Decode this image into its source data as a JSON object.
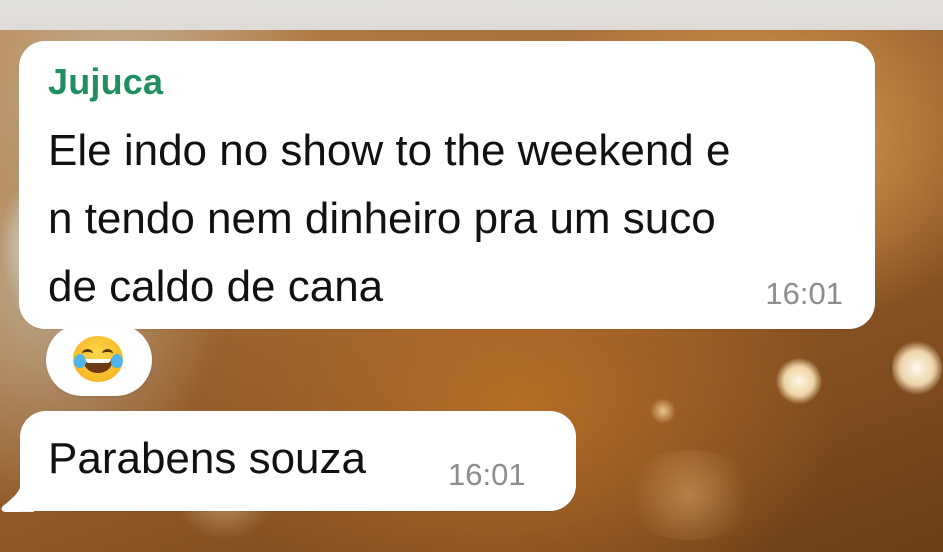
{
  "messages": [
    {
      "sender": "Jujuca",
      "lines": [
        "Ele indo no show to the weekend e",
        "n tendo nem dinheiro pra um suco",
        "de caldo de cana"
      ],
      "time": "16:01",
      "reaction": "face-with-tears-of-joy-icon"
    },
    {
      "text": "Parabens souza",
      "time": "16:01"
    }
  ],
  "colors": {
    "sender_name": "#1f8f61",
    "bubble": "#ffffff",
    "timestamp": "#8d8d8d",
    "message_text": "#111111"
  }
}
